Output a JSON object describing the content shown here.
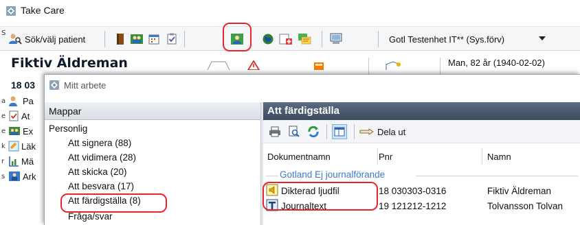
{
  "app": {
    "title": "Take Care"
  },
  "toolbar": {
    "search_patient_label": "Sök/välj patient",
    "unit_selected": "Gotl Testenhet IT** (Sys.förv)",
    "left_edge_char": "S"
  },
  "patient": {
    "name": "Fiktiv Äldreman",
    "pnr_prefix": "18 03",
    "info": "Man, 82 år (1940-02-02)"
  },
  "left_strip": [
    {
      "edge": "e",
      "label": ""
    },
    {
      "edge": "a",
      "label": "Pa"
    },
    {
      "edge": "e",
      "label": "At"
    },
    {
      "edge": "e",
      "label": "Ex"
    },
    {
      "edge": "k",
      "label": "Läk"
    },
    {
      "edge": "r",
      "label": "Mä"
    },
    {
      "edge": "s",
      "label": "Ark"
    }
  ],
  "dialog": {
    "title": "Mitt arbete",
    "folders_header": "Mappar",
    "folders": {
      "group": "Personlig",
      "items": [
        {
          "label": "Att signera (88)"
        },
        {
          "label": "Att vidimera (28)"
        },
        {
          "label": "Att skicka (20)"
        },
        {
          "label": "Att besvara (17)"
        },
        {
          "label": "Att färdigställa (8)"
        },
        {
          "label": "Fråga/svar"
        }
      ]
    },
    "pane": {
      "title": "Att färdigställa",
      "dela_ut_label": "Dela ut",
      "columns": {
        "doc": "Dokumentnamn",
        "pnr": "Pnr",
        "name": "Namn"
      },
      "group_label": "Gotland Ej journalförande",
      "rows": [
        {
          "doc": "Dikterad ljudfil",
          "pnr": "18 030303-0316",
          "name": "Fiktiv Äldreman"
        },
        {
          "doc": "Journaltext",
          "pnr": "19 121212-1212",
          "name": "Tolvansson Tolvan"
        }
      ]
    }
  },
  "colors": {
    "highlight": "#e8242f",
    "pane_header": "#4a5970",
    "group_label": "#3a7bd5"
  }
}
